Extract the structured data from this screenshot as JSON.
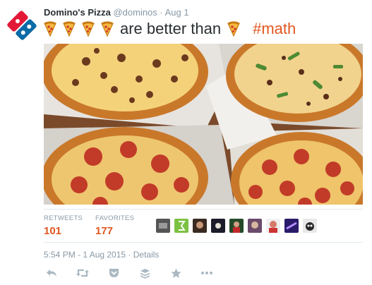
{
  "tweet": {
    "author_name": "Domino's Pizza",
    "handle_date": "@dominos · Aug 1",
    "text_word": "are better than",
    "hashtag": "#math",
    "timestamp": "5:54 PM - 1 Aug 2015 · Details"
  },
  "stats": {
    "retweets_label": "RETWEETS",
    "retweets_value": "101",
    "favorites_label": "FAVORITES",
    "favorites_value": "177"
  },
  "icons": [
    "pizza-slice-icon",
    "reply-icon",
    "retweet-icon",
    "pocket-icon",
    "buffer-icon",
    "favorite-icon",
    "more-icon"
  ],
  "colors": {
    "brand_blue": "#0b6ba6",
    "brand_red": "#e31837",
    "accent_orange": "#e0561f",
    "meta_gray": "#8899a6"
  }
}
